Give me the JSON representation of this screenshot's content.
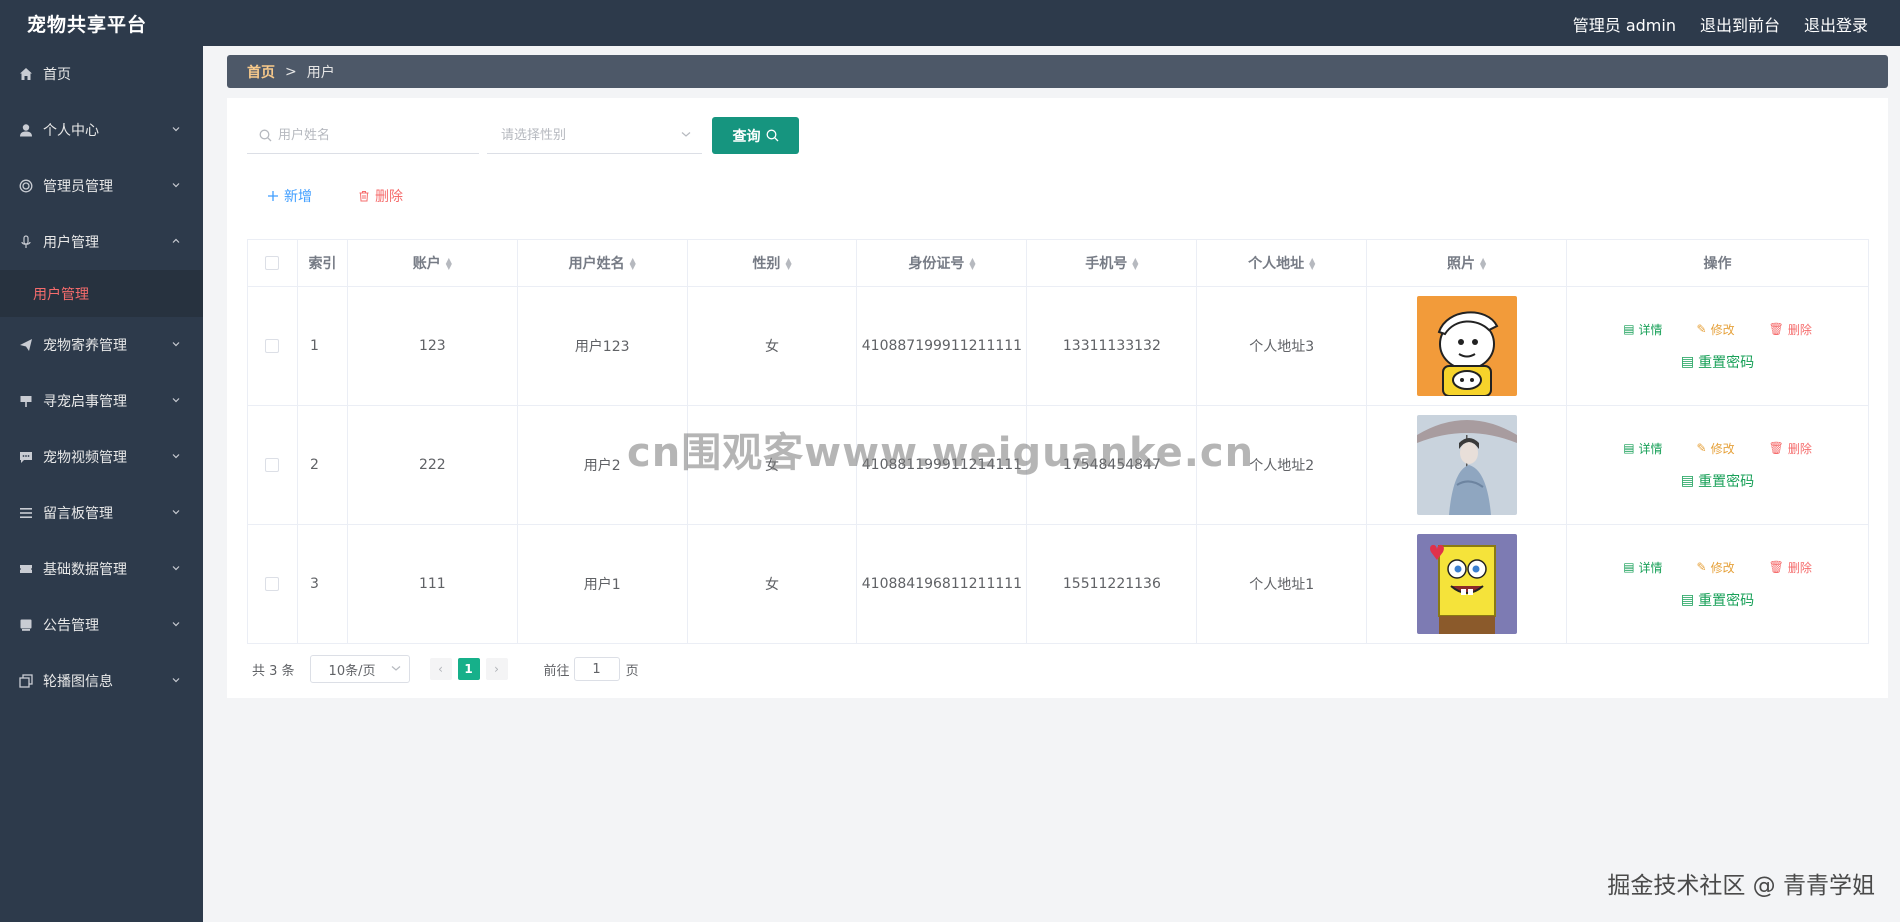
{
  "header": {
    "title": "宠物共享平台",
    "role_user": "管理员 admin",
    "to_front": "退出到前台",
    "logout": "退出登录"
  },
  "sidebar": {
    "items": [
      {
        "label": "首页",
        "icon": "home-icon",
        "expandable": false
      },
      {
        "label": "个人中心",
        "icon": "user-icon",
        "expandable": true
      },
      {
        "label": "管理员管理",
        "icon": "admin-icon",
        "expandable": true
      },
      {
        "label": "用户管理",
        "icon": "mic-icon",
        "expandable": true,
        "expanded": true,
        "children": [
          {
            "label": "用户管理",
            "active": true
          }
        ]
      },
      {
        "label": "宠物寄养管理",
        "icon": "send-icon",
        "expandable": true
      },
      {
        "label": "寻宠启事管理",
        "icon": "sign-icon",
        "expandable": true
      },
      {
        "label": "宠物视频管理",
        "icon": "chat-icon",
        "expandable": true
      },
      {
        "label": "留言板管理",
        "icon": "list-icon",
        "expandable": true
      },
      {
        "label": "基础数据管理",
        "icon": "ticket-icon",
        "expandable": true
      },
      {
        "label": "公告管理",
        "icon": "message-icon",
        "expandable": true
      },
      {
        "label": "轮播图信息",
        "icon": "copy-icon",
        "expandable": true
      }
    ]
  },
  "breadcrumb": {
    "home": "首页",
    "separator": ">",
    "current": "用户"
  },
  "search": {
    "name_placeholder": "用户姓名",
    "gender_placeholder": "请选择性别",
    "query_label": "查询"
  },
  "actions": {
    "add_label": "新增",
    "delete_label": "删除"
  },
  "table": {
    "columns": [
      "索引",
      "账户",
      "用户姓名",
      "性别",
      "身份证号",
      "手机号",
      "个人地址",
      "照片",
      "操作"
    ],
    "rows": [
      {
        "index": "1",
        "account": "123",
        "name": "用户123",
        "gender": "女",
        "id_card": "410887199911211111",
        "phone": "13311133132",
        "address": "个人地址3",
        "photo": "cartoon-boy-avatar"
      },
      {
        "index": "2",
        "account": "222",
        "name": "用户2",
        "gender": "女",
        "id_card": "410881199911214111",
        "phone": "17548454847",
        "address": "个人地址2",
        "photo": "umbrella-person-avatar"
      },
      {
        "index": "3",
        "account": "111",
        "name": "用户1",
        "gender": "女",
        "id_card": "410884196811211111",
        "phone": "15511221136",
        "address": "个人地址1",
        "photo": "spongebob-avatar"
      }
    ],
    "ops": {
      "detail": "详情",
      "edit": "修改",
      "delete": "删除",
      "reset": "重置密码"
    }
  },
  "pagination": {
    "total": "共 3 条",
    "page_size": "10条/页",
    "current_page": "1",
    "goto_label": "前往",
    "goto_value": "1",
    "page_unit": "页"
  },
  "overlay": {
    "watermark": "cn围观客www.weiguanke.cn",
    "credit": "掘金技术社区 @ 青青学姐"
  },
  "colors": {
    "sidebar_bg": "#2d3a4b",
    "accent": "#16957f",
    "danger": "#f56c6c",
    "warning": "#e6a23c",
    "success": "#18a058"
  }
}
